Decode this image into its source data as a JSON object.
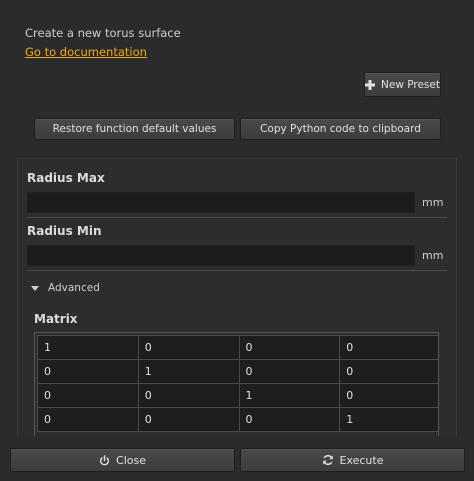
{
  "header": {
    "description": "Create a new torus surface",
    "doc_link": "Go to documentation"
  },
  "presets": {
    "new_preset_label": "New Preset"
  },
  "actions": {
    "restore_label": "Restore function default values",
    "copy_label": "Copy Python code to clipboard"
  },
  "params": {
    "radius_max": {
      "label": "Radius Max",
      "value": "",
      "unit": "mm"
    },
    "radius_min": {
      "label": "Radius Min",
      "value": "",
      "unit": "mm"
    }
  },
  "advanced": {
    "label": "Advanced",
    "matrix_label": "Matrix",
    "matrix": [
      [
        "1",
        "0",
        "0",
        "0"
      ],
      [
        "0",
        "1",
        "0",
        "0"
      ],
      [
        "0",
        "0",
        "1",
        "0"
      ],
      [
        "0",
        "0",
        "0",
        "1"
      ]
    ]
  },
  "footer": {
    "close_label": "Close",
    "execute_label": "Execute"
  },
  "colors": {
    "background": "#2b2b2b",
    "link": "#f0a81e",
    "field": "#1c1c1c"
  }
}
